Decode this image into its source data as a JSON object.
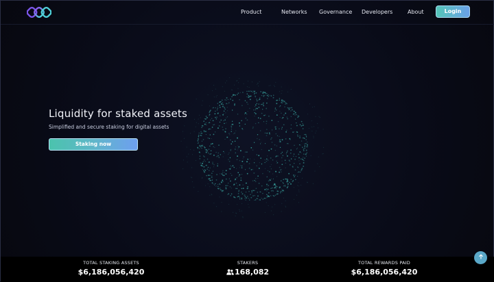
{
  "header": {
    "logo_icon": "infinity-rings-logo",
    "nav": [
      {
        "label": "Product"
      },
      {
        "label": "Networks"
      },
      {
        "label": "Governance"
      },
      {
        "label": "Developers"
      },
      {
        "label": "About"
      }
    ],
    "login_label": "Login"
  },
  "hero": {
    "title": "Liquidity for staked assets",
    "subtitle": "Simplified and secure staking for digital assets",
    "cta_label": "Staking now"
  },
  "stats": {
    "total_staking_assets_label": "TOTAL STAKING ASSETS",
    "total_staking_assets_value": "$6,186,056,420",
    "stakers_label": "STAKERS",
    "stakers_value": "168,082",
    "stakers_icon": "users-icon",
    "total_rewards_label": "TOTAL REWARDS PAID",
    "total_rewards_value": "$6,186,056,420"
  },
  "scroll_top_icon": "arrow-up-icon",
  "colors": {
    "background": "#0a0c1a",
    "accent_start": "#4bc3ad",
    "accent_end": "#6e9ff0",
    "particle": "#3fb8b0"
  }
}
